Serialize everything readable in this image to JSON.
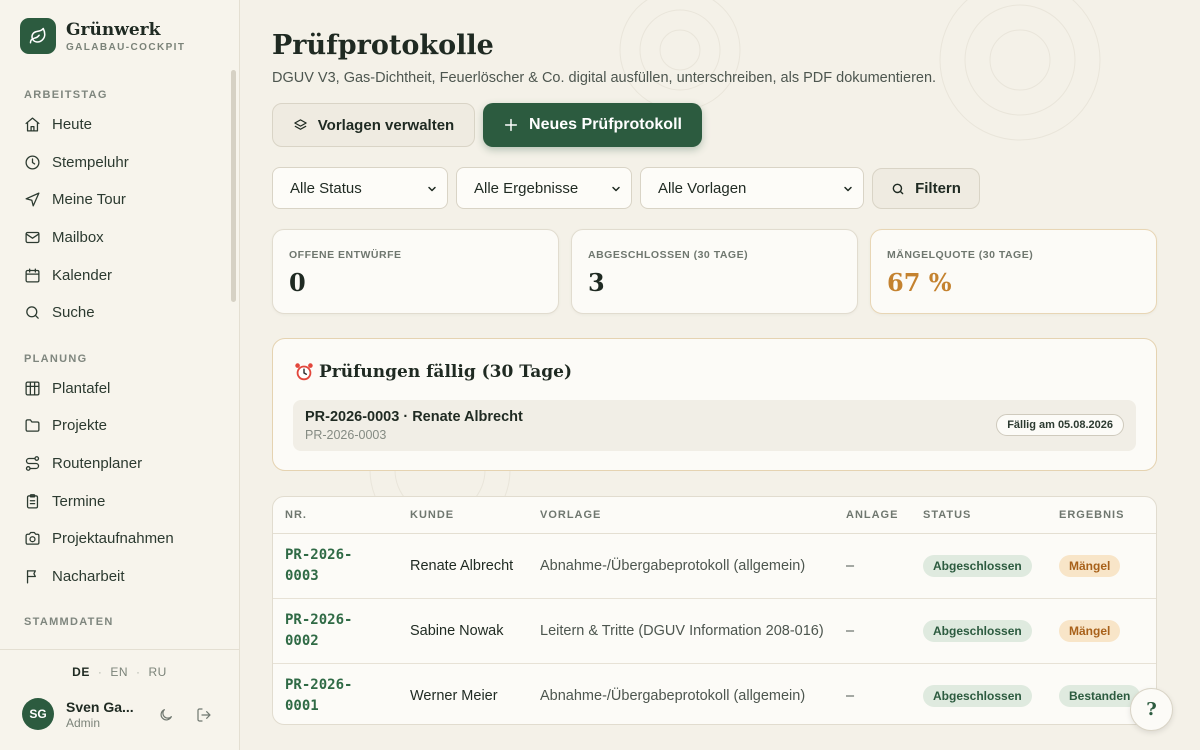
{
  "brand": {
    "name": "Grünwerk",
    "subtitle": "GALABAU-COCKPIT"
  },
  "sidebar": {
    "sections": [
      {
        "label": "ARBEITSTAG",
        "items": [
          {
            "label": "Heute",
            "icon": "home-icon"
          },
          {
            "label": "Stempeluhr",
            "icon": "clock-icon"
          },
          {
            "label": "Meine Tour",
            "icon": "navigation-icon"
          },
          {
            "label": "Mailbox",
            "icon": "mail-icon"
          },
          {
            "label": "Kalender",
            "icon": "calendar-icon"
          },
          {
            "label": "Suche",
            "icon": "search-icon"
          }
        ]
      },
      {
        "label": "PLANUNG",
        "items": [
          {
            "label": "Plantafel",
            "icon": "grid-icon"
          },
          {
            "label": "Projekte",
            "icon": "folder-icon"
          },
          {
            "label": "Routenplaner",
            "icon": "route-icon"
          },
          {
            "label": "Termine",
            "icon": "clipboard-icon"
          },
          {
            "label": "Projektaufnahmen",
            "icon": "camera-icon"
          },
          {
            "label": "Nacharbeit",
            "icon": "flag-icon"
          }
        ]
      },
      {
        "label": "STAMMDATEN",
        "items": []
      }
    ],
    "languages": [
      "DE",
      "EN",
      "RU"
    ],
    "active_language": "DE",
    "user": {
      "initials": "SG",
      "name": "Sven Ga...",
      "role": "Admin"
    }
  },
  "page": {
    "title": "Prüfprotokolle",
    "subtitle": "DGUV V3, Gas-Dichtheit, Feuerlöscher & Co. digital ausfüllen, unterschreiben, als PDF dokumentieren.",
    "manage_templates_label": "Vorlagen verwalten",
    "new_protocol_label": "Neues Prüfprotokoll"
  },
  "filters": {
    "status": "Alle Status",
    "result": "Alle Ergebnisse",
    "template": "Alle Vorlagen",
    "filter_label": "Filtern"
  },
  "stats": [
    {
      "label": "OFFENE ENTWÜRFE",
      "value": "0"
    },
    {
      "label": "ABGESCHLOSSEN (30 TAGE)",
      "value": "3"
    },
    {
      "label": "MÄNGELQUOTE (30 TAGE)",
      "value": "67 %"
    }
  ],
  "due": {
    "title": "Prüfungen fällig (30 Tage)",
    "items": [
      {
        "title": "PR-2026-0003 · Renate Albrecht",
        "sub": "PR-2026-0003",
        "badge": "Fällig am 05.08.2026"
      }
    ]
  },
  "table": {
    "headers": [
      "NR.",
      "KUNDE",
      "VORLAGE",
      "ANLAGE",
      "STATUS",
      "ERGEBNIS"
    ],
    "rows": [
      {
        "nr": "PR-2026-0003",
        "kunde": "Renate Albrecht",
        "vorlage": "Abnahme-/Übergabeprotokoll (allgemein)",
        "anlage": "–",
        "status": "Abgeschlossen",
        "ergebnis": "Mängel"
      },
      {
        "nr": "PR-2026-0002",
        "kunde": "Sabine Nowak",
        "vorlage": "Leitern & Tritte (DGUV Information 208-016)",
        "anlage": "–",
        "status": "Abgeschlossen",
        "ergebnis": "Mängel"
      },
      {
        "nr": "PR-2026-0001",
        "kunde": "Werner Meier",
        "vorlage": "Abnahme-/Übergabeprotokoll (allgemein)",
        "anlage": "–",
        "status": "Abgeschlossen",
        "ergebnis": "Bestanden"
      }
    ]
  },
  "help_label": "?",
  "colors": {
    "primary": "#2c5b3f",
    "warning": "#c4822f",
    "background": "#f4f1e8"
  }
}
